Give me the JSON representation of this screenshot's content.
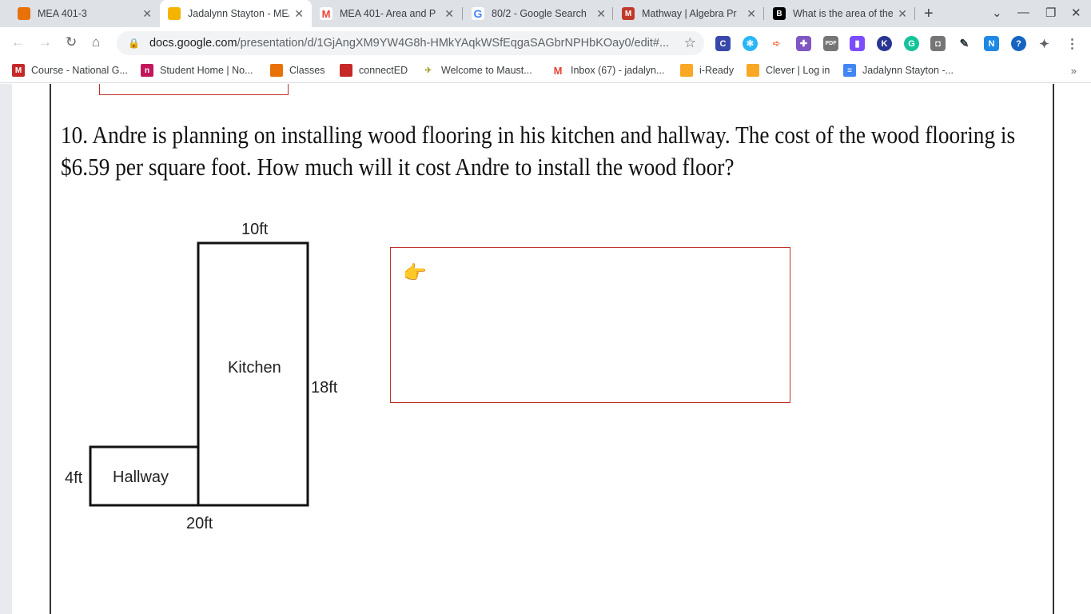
{
  "tabs": [
    {
      "title": "MEA 401-3",
      "icon": "slides-icon",
      "color": "#e8710a"
    },
    {
      "title": "Jadalynn Stayton - MEA",
      "icon": "slides-icon",
      "color": "#f4b400",
      "active": true
    },
    {
      "title": "MEA 401- Area and P",
      "icon": "gmail-icon",
      "color": "#ea4335"
    },
    {
      "title": "80/2 - Google Search",
      "icon": "google-icon",
      "color": "#4285f4"
    },
    {
      "title": "Mathway | Algebra Pr",
      "icon": "mathway-icon",
      "color": "#c0392b"
    },
    {
      "title": "What is the area of the",
      "icon": "brainly-icon",
      "color": "#000000"
    }
  ],
  "toolbar": {
    "url_host": "docs.google.com",
    "url_path": "/presentation/d/1GjAngXM9YW4G8h-HMkYAqkWSfEqgaSAGbrNPHbKOay0/edit#..."
  },
  "bookmarks": [
    {
      "label": "Course - National G...",
      "color": "#c62828",
      "glyph": "M"
    },
    {
      "label": "Student Home | No...",
      "color": "#c2185b",
      "glyph": "n"
    },
    {
      "label": "Classes",
      "color": "#e8710a",
      "glyph": ""
    },
    {
      "label": "connectED",
      "color": "#c62828",
      "glyph": ""
    },
    {
      "label": "Welcome to Maust...",
      "color": "#9e9d24",
      "glyph": ""
    },
    {
      "label": "Inbox (67) - jadalyn...",
      "color": "#ea4335",
      "glyph": "M"
    },
    {
      "label": "i-Ready",
      "color": "#f9a825",
      "glyph": ""
    },
    {
      "label": "Clever | Log in",
      "color": "#f9a825",
      "glyph": ""
    },
    {
      "label": "Jadalynn Stayton -...",
      "color": "#4285f4",
      "glyph": "≡"
    }
  ],
  "slide": {
    "question": "10.  Andre is planning on installing wood flooring in his kitchen and hallway.  The cost of the wood flooring is $6.59 per square foot.  How much will it cost Andre to install the wood floor?",
    "diagram": {
      "top_label": "10ft",
      "kitchen_label": "Kitchen",
      "right_label": "18ft",
      "left_label": "4ft",
      "hallway_label": "Hallway",
      "bottom_label": "20ft"
    },
    "pointer_emoji": "👉"
  }
}
